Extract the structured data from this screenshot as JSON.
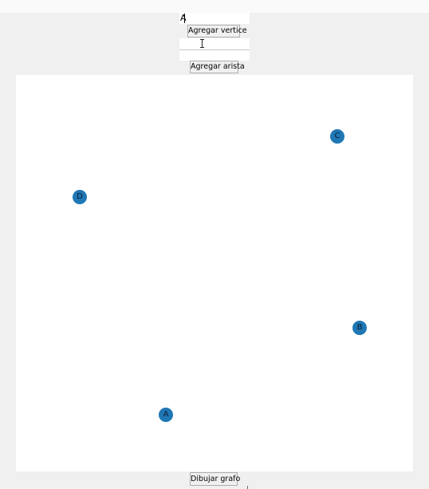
{
  "vertex_form": {
    "vertex_value": "A",
    "add_vertex_label": "Agregar vertice"
  },
  "edge_form": {
    "from_value": "",
    "to_value": "",
    "add_edge_label": "Agregar arista"
  },
  "graph": {
    "node_color": "#1f77b4",
    "nodes": [
      {
        "label": "C"
      },
      {
        "label": "D"
      },
      {
        "label": "B"
      },
      {
        "label": "A"
      }
    ]
  },
  "draw_label": "Dibujar grafo"
}
